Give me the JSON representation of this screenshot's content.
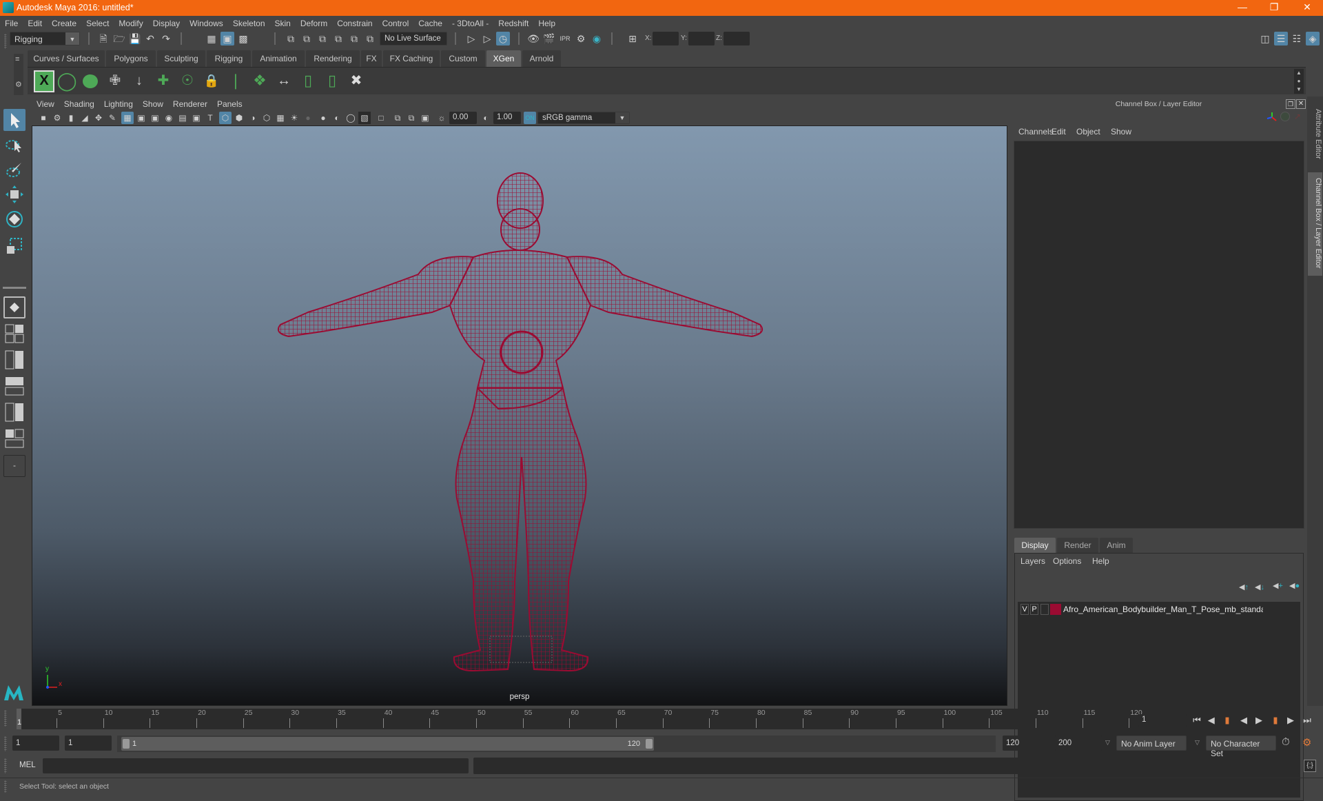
{
  "window": {
    "title": "Autodesk Maya 2016: untitled*",
    "controls": [
      "minimize",
      "restore",
      "close"
    ]
  },
  "menubar": [
    "File",
    "Edit",
    "Create",
    "Select",
    "Modify",
    "Display",
    "Windows",
    "Skeleton",
    "Skin",
    "Deform",
    "Constrain",
    "Control",
    "Cache",
    "- 3DtoAll -",
    "Redshift",
    "Help"
  ],
  "statusline": {
    "menuset": "Rigging",
    "live_surface": "No Live Surface",
    "x_label": "X:",
    "y_label": "Y:",
    "z_label": "Z:",
    "x_value": "",
    "y_value": "",
    "z_value": ""
  },
  "shelf": {
    "tabs": [
      "Curves / Surfaces",
      "Polygons",
      "Sculpting",
      "Rigging",
      "Animation",
      "Rendering",
      "FX",
      "FX Caching",
      "Custom",
      "XGen",
      "Arnold"
    ],
    "active_tab": "XGen",
    "icons": [
      "xgen-window-icon",
      "xgen-preview-icon",
      "xgen-clear-preview-icon",
      "xgen-add-description-icon",
      "xgen-move-guides-icon",
      "xgen-add-guide-icon",
      "xgen-guide-visibility-icon",
      "xgen-lock-guides-icon",
      "xgen-split-guides-icon",
      "xgen-groom-icon",
      "xgen-flip-guides-icon",
      "xgen-select-guides-icon",
      "xgen-guide-bounds-icon",
      "xgen-delete-guide-icon"
    ]
  },
  "viewport": {
    "menu": [
      "View",
      "Shading",
      "Lighting",
      "Show",
      "Renderer",
      "Panels"
    ],
    "exposure": "0.00",
    "gamma": "1.00",
    "color_management": "sRGB gamma",
    "camera_label": "persp",
    "axis_x": "x",
    "axis_y": "y",
    "wireframe_color": "#9b0b32"
  },
  "channel_box": {
    "title": "Channel Box / Layer Editor",
    "menu": [
      "Channels",
      "Edit",
      "Object",
      "Show"
    ]
  },
  "layer_editor": {
    "tabs": [
      "Display",
      "Render",
      "Anim"
    ],
    "active_tab": "Display",
    "menu": [
      "Layers",
      "Options",
      "Help"
    ],
    "layers": [
      {
        "visible": "V",
        "playback": "P",
        "color": "#9b0b32",
        "name": "Afro_American_Bodybuilder_Man_T_Pose_mb_standart:A"
      }
    ]
  },
  "side_tabs": [
    "Attribute Editor",
    "Channel Box / Layer Editor"
  ],
  "timeline": {
    "ticks": [
      5,
      10,
      15,
      20,
      25,
      30,
      35,
      40,
      45,
      50,
      55,
      60,
      65,
      70,
      75,
      80,
      85,
      90,
      95,
      100,
      105,
      110,
      115,
      120
    ],
    "range_min": 1,
    "range_max": 120,
    "current_frame_marker": "1",
    "current_frame": "1"
  },
  "range_slider": {
    "start_time": "1",
    "playback_start": "1",
    "slider_start": "1",
    "slider_end": "120",
    "playback_end": "120",
    "end_time": "200",
    "anim_layer": "No Anim Layer",
    "character_set": "No Character Set"
  },
  "command_line": {
    "label": "MEL",
    "value": "",
    "result": ""
  },
  "help_line": "Select Tool: select an object"
}
